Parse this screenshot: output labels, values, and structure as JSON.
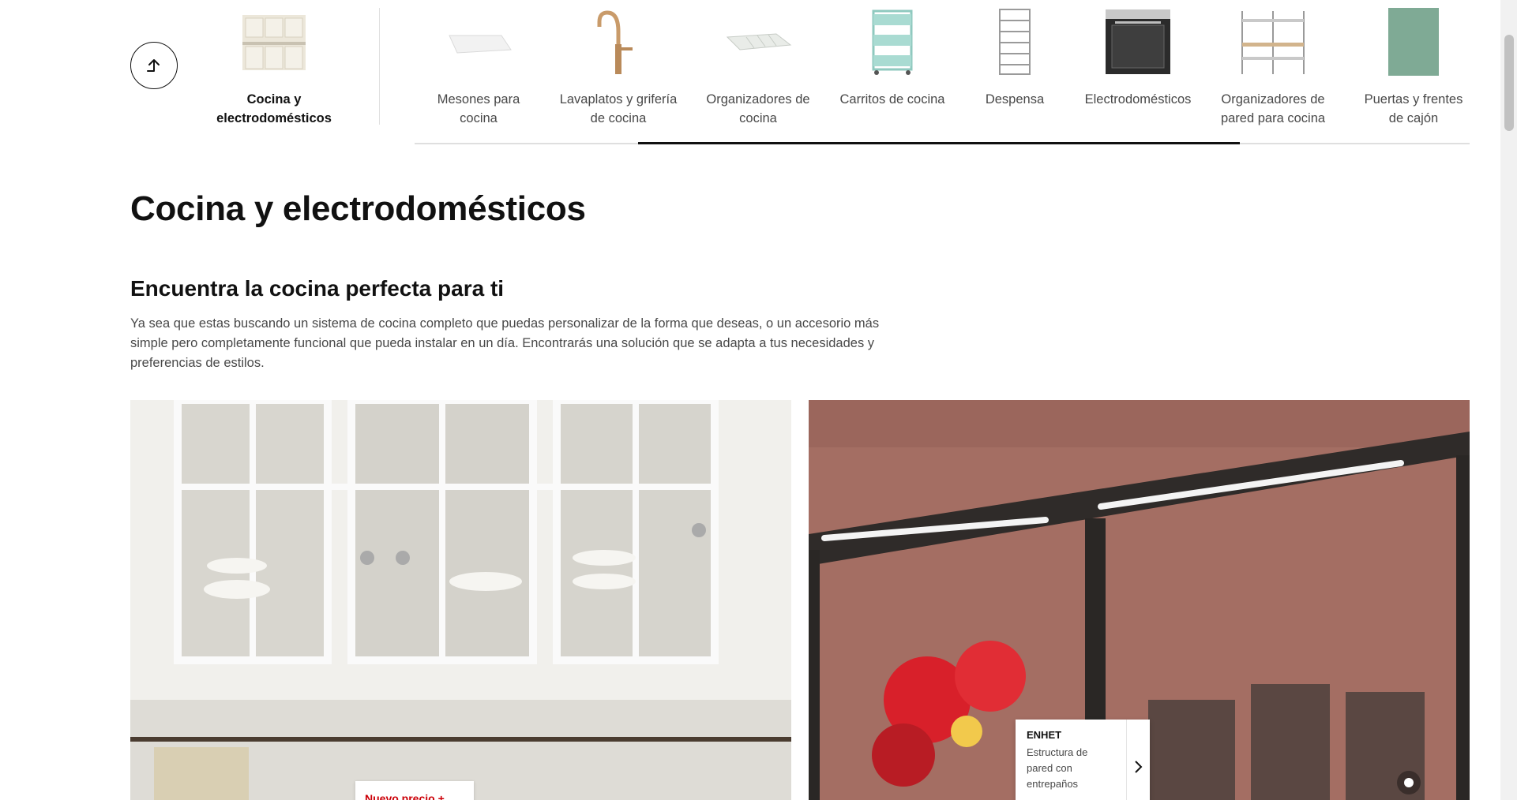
{
  "category_nav": {
    "up_button_label": "Subir nivel",
    "current": {
      "label": "Cocina y electrodomésticos"
    },
    "items": [
      {
        "label": "Mesones para cocina"
      },
      {
        "label": "Lavaplatos y grifería de cocina"
      },
      {
        "label": "Organizadores de cocina"
      },
      {
        "label": "Carritos de cocina"
      },
      {
        "label": "Despensa"
      },
      {
        "label": "Electrodomésticos"
      },
      {
        "label": "Organizadores de pared para cocina"
      },
      {
        "label": "Puertas y frentes de cajón"
      }
    ]
  },
  "page": {
    "title": "Cocina y electrodomésticos",
    "section_title": "Encuentra la cocina perfecta para ti",
    "section_text": "Ya sea que estas buscando un sistema de cocina completo que puedas personalizar de la forma que deseas, o un accesorio más simple pero completamente funcional que pueda instalar en un día. Encontrarás una solución que se adapta a tus necesidades y preferencias de estilos."
  },
  "promos": {
    "left": {
      "price_tag": "Nuevo precio +"
    },
    "right": {
      "product_name": "ENHET",
      "product_desc": "Estructura de pared con entrepaños"
    }
  },
  "colors": {
    "price_red": "#cc0008",
    "text_dark": "#111111",
    "text_muted": "#484848"
  }
}
